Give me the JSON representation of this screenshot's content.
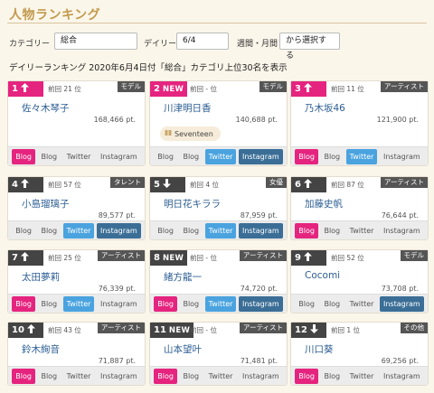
{
  "title": "人物ランキング",
  "filters": {
    "category_label": "カテゴリー",
    "category_value": "総合",
    "daily_label": "デイリー",
    "daily_value": "6/4",
    "period_label": "週間・月間",
    "period_value": "から選択する"
  },
  "subheading": "デイリーランキング 2020年6月4日付「総合」カテゴリ上位30名を表示",
  "link_labels": [
    "Blog",
    "Blog",
    "Twitter",
    "Instagram"
  ],
  "colors": {
    "accent_pink": "#e5247f",
    "twitter_blue": "#4aa3df",
    "instagram_blue": "#3b6e96",
    "title_gold": "#c39a4e"
  },
  "cards": [
    {
      "rank": "1",
      "trend": "up",
      "prev": "前回 21 位",
      "category": "モデル",
      "name": "佐々木琴子",
      "points": "168,466 pt.",
      "group": "",
      "active": [
        true,
        false,
        false,
        false
      ]
    },
    {
      "rank": "2",
      "trend": "new",
      "trend_text": "NEW",
      "prev": "前回 - 位",
      "category": "モデル",
      "name": "川津明日香",
      "points": "140,688 pt.",
      "group": "Seventeen",
      "active": [
        false,
        false,
        true,
        true
      ]
    },
    {
      "rank": "3",
      "trend": "up",
      "prev": "前回 11 位",
      "category": "アーティスト",
      "name": "乃木坂46",
      "points": "121,900 pt.",
      "group": "",
      "active": [
        true,
        false,
        true,
        false
      ]
    },
    {
      "rank": "4",
      "trend": "up",
      "prev": "前回 57 位",
      "category": "タレント",
      "name": "小島瑠璃子",
      "points": "89,577 pt.",
      "group": "",
      "active": [
        false,
        false,
        true,
        true
      ]
    },
    {
      "rank": "5",
      "trend": "down",
      "prev": "前回 4 位",
      "category": "女優",
      "name": "明日花キララ",
      "points": "87,959 pt.",
      "group": "",
      "active": [
        false,
        false,
        true,
        true
      ]
    },
    {
      "rank": "6",
      "trend": "up",
      "prev": "前回 87 位",
      "category": "アーティスト",
      "name": "加藤史帆",
      "points": "76,644 pt.",
      "group": "",
      "active": [
        true,
        false,
        false,
        false
      ]
    },
    {
      "rank": "7",
      "trend": "up",
      "prev": "前回 25 位",
      "category": "アーティスト",
      "name": "太田夢莉",
      "points": "76,339 pt.",
      "group": "",
      "active": [
        true,
        false,
        true,
        false
      ]
    },
    {
      "rank": "8",
      "trend": "new",
      "trend_text": "NEW",
      "prev": "前回 - 位",
      "category": "アーティスト",
      "name": "緒方龍一",
      "points": "74,720 pt.",
      "group": "",
      "active": [
        true,
        false,
        true,
        true
      ]
    },
    {
      "rank": "9",
      "trend": "up",
      "prev": "前回 52 位",
      "category": "モデル",
      "name": "Cocomi",
      "points": "73,708 pt.",
      "group": "",
      "active": [
        false,
        false,
        false,
        true
      ]
    },
    {
      "rank": "10",
      "trend": "up",
      "prev": "前回 43 位",
      "category": "アーティスト",
      "name": "鈴木絢音",
      "points": "71,887 pt.",
      "group": "",
      "active": [
        true,
        false,
        false,
        false
      ]
    },
    {
      "rank": "11",
      "trend": "new",
      "trend_text": "NEW",
      "prev": "前回 - 位",
      "category": "アーティスト",
      "name": "山本望叶",
      "points": "71,481 pt.",
      "group": "",
      "active": [
        true,
        false,
        false,
        false
      ]
    },
    {
      "rank": "12",
      "trend": "down",
      "prev": "前回 1 位",
      "category": "その他",
      "name": "川口葵",
      "points": "69,256 pt.",
      "group": "",
      "active": [
        true,
        false,
        false,
        false
      ]
    }
  ]
}
